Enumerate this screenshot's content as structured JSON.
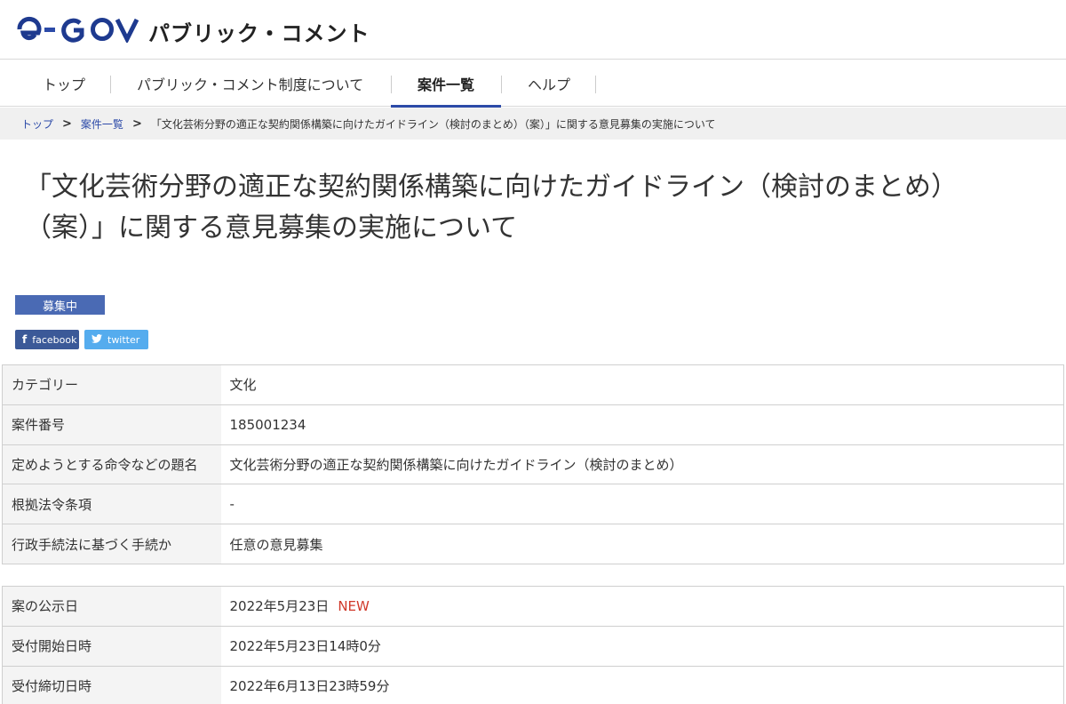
{
  "header": {
    "logo_text": "e-GOV",
    "site_title": "パブリック・コメント"
  },
  "nav": {
    "items": [
      {
        "label": "トップ"
      },
      {
        "label": "パブリック・コメント制度について"
      },
      {
        "label": "案件一覧"
      },
      {
        "label": "ヘルプ"
      }
    ],
    "active": "案件一覧"
  },
  "breadcrumb": {
    "items": [
      "トップ",
      "案件一覧"
    ],
    "current": "「文化芸術分野の適正な契約関係構築に向けたガイドライン（検討のまとめ）（案）」に関する意見募集の実施について",
    "separator": ">"
  },
  "page": {
    "title_line1": "「文化芸術分野の適正な契約関係構築に向けたガイドライン（検討のまとめ）",
    "title_line2": "（案）」に関する意見募集の実施について",
    "status": "募集中"
  },
  "share": {
    "facebook": "facebook",
    "twitter": "twitter",
    "facebook_icon": "f",
    "twitter_icon": "twitter-bird-icon"
  },
  "details": {
    "category_label": "カテゴリー",
    "category_value": "文化",
    "case_no_label": "案件番号",
    "case_no_value": "185001234",
    "subject_label": "定めようとする命令などの題名",
    "subject_value": "文化芸術分野の適正な契約関係構築に向けたガイドライン（検討のまとめ）",
    "law_label": "根拠法令条項",
    "law_value": "-",
    "procedure_label": "行政手続法に基づく手続か",
    "procedure_value": "任意の意見募集"
  },
  "dates": {
    "published_label": "案の公示日",
    "published_value": "2022年5月23日",
    "new_badge": "NEW",
    "start_label": "受付開始日時",
    "start_value": "2022年5月23日14時0分",
    "end_label": "受付締切日時",
    "end_value": "2022年6月13日23時59分"
  },
  "colors": {
    "brand_blue": "#2c4aa8",
    "status_badge": "#4a6ab4",
    "facebook": "#3b5998",
    "twitter": "#55acee",
    "new": "#d0392a"
  }
}
